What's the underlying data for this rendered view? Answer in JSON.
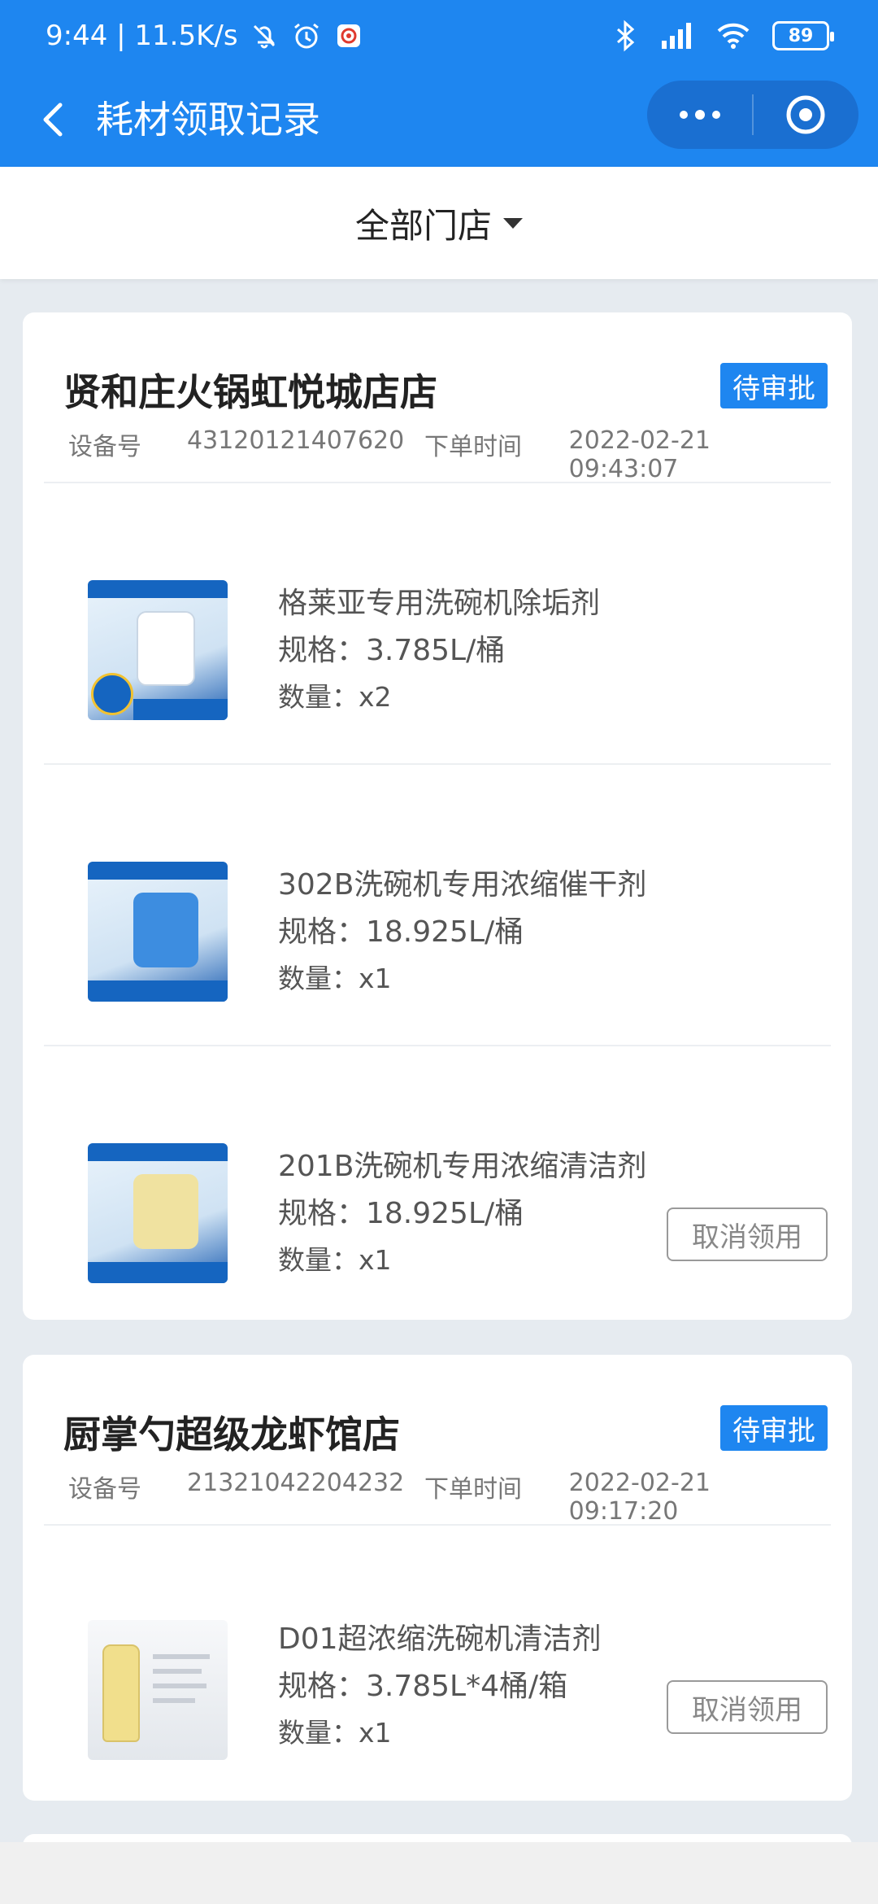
{
  "status_bar": {
    "time_speed": "9:44 | 11.5K/s",
    "battery": "89"
  },
  "nav": {
    "title": "耗材领取记录"
  },
  "filter": {
    "label": "全部门店"
  },
  "orders": [
    {
      "store": "贤和庄火锅虹悦城店店",
      "status": "待审批",
      "device_label": "设备号",
      "device_no": "43120121407620",
      "time_label": "下单时间",
      "time": "2022-02-21 09:43:07",
      "items": [
        {
          "name": "格莱亚专用洗碗机除垢剂",
          "spec": "规格：3.785L/桶",
          "qty": "数量：x2"
        },
        {
          "name": "302B洗碗机专用浓缩催干剂",
          "spec": "规格：18.925L/桶",
          "qty": "数量：x1"
        },
        {
          "name": "201B洗碗机专用浓缩清洁剂",
          "spec": "规格：18.925L/桶",
          "qty": "数量：x1"
        }
      ],
      "cancel_label": "取消领用"
    },
    {
      "store": "厨掌勺超级龙虾馆店",
      "status": "待审批",
      "device_label": "设备号",
      "device_no": "21321042204232",
      "time_label": "下单时间",
      "time": "2022-02-21 09:17:20",
      "items": [
        {
          "name": "D01超浓缩洗碗机清洁剂",
          "spec": "规格：3.785L*4桶/箱",
          "qty": "数量：x1"
        }
      ],
      "cancel_label": "取消领用"
    }
  ],
  "colors": {
    "brand_blue": "#1e86f0",
    "background": "#e6ebf0"
  }
}
